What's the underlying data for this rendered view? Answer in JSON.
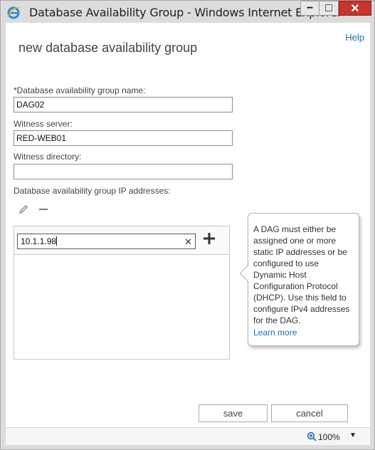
{
  "window": {
    "title": "Database Availability Group - Windows Internet Explorer",
    "minimize_glyph": "−",
    "maximize_glyph": "□",
    "close_glyph": "✕"
  },
  "header": {
    "help": "Help",
    "heading": "new database availability group"
  },
  "form": {
    "dag_name_label": "*Database availability group name:",
    "dag_name_value": "DAG02",
    "witness_server_label": "Witness server:",
    "witness_server_value": "RED-WEB01",
    "witness_directory_label": "Witness directory:",
    "witness_directory_value": "",
    "ip_addresses_label": "Database availability group IP addresses:",
    "ip_input_value": "10.1.1.98",
    "clear_glyph": "✕",
    "ip_list": []
  },
  "callout": {
    "text": "A DAG must either be assigned one or more static IP addresses or be configured to use Dynamic Host Configuration Protocol (DHCP). Use this field to configure IPv4 addresses for the DAG.",
    "learn_more": "Learn more"
  },
  "buttons": {
    "save": "save",
    "cancel": "cancel"
  },
  "statusbar": {
    "zoom": "100%"
  },
  "colors": {
    "link": "#1a6fb0",
    "close_button": "#c7352d"
  },
  "icons": [
    "ie-icon",
    "pencil-icon",
    "minus-icon",
    "plus-icon",
    "zoom-icon",
    "chevron-down-icon"
  ]
}
